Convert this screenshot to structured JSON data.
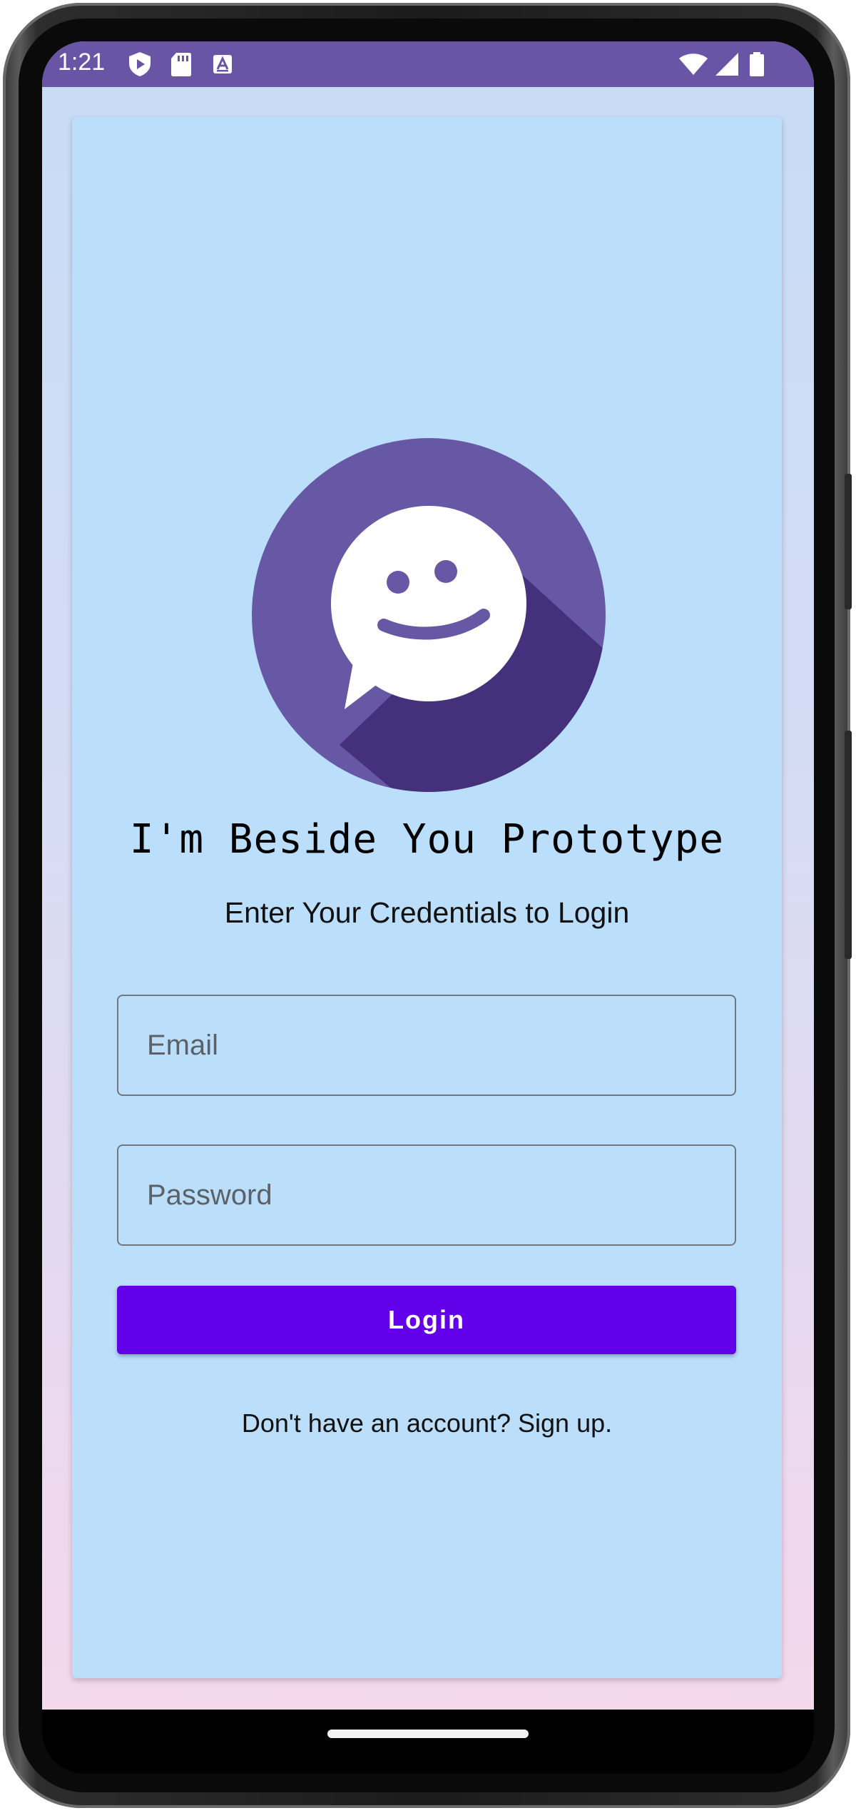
{
  "status_bar": {
    "time": "1:21",
    "left_icons": [
      "play-protect-icon",
      "sd-card-icon",
      "keyboard-icon"
    ],
    "right_icons": [
      "wifi-icon",
      "cell-signal-icon",
      "battery-icon"
    ],
    "background_color": "#6a54a6"
  },
  "login": {
    "app_title": "I'm Beside You Prototype",
    "subtitle": "Enter Your Credentials to Login",
    "email_placeholder": "Email",
    "email_value": "",
    "password_placeholder": "Password",
    "password_value": "",
    "login_button_label": "Login",
    "signup_text": "Don't have an account? Sign up."
  },
  "colors": {
    "card_background": "#bbdefb",
    "logo_circle": "#6658a4",
    "logo_shadow": "#45307b",
    "button": "#6200ea"
  }
}
